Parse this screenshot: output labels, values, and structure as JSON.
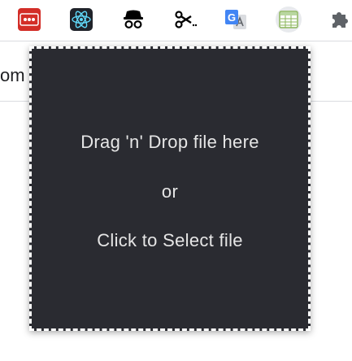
{
  "toolbar": {
    "extensions": [
      {
        "name": "lastpass-icon"
      },
      {
        "name": "react-devtools-icon"
      },
      {
        "name": "incognito-icon"
      },
      {
        "name": "scissors-icon"
      },
      {
        "name": "google-translate-icon"
      },
      {
        "name": "table-capture-icon"
      },
      {
        "name": "puzzle-icon"
      }
    ]
  },
  "background": {
    "partial_text": "om"
  },
  "dropzone": {
    "line1": "Drag 'n' Drop file here",
    "line2": "or",
    "line3": "Click to Select file"
  },
  "colors": {
    "dropzone_bg": "#2a2b31",
    "dropzone_text": "#e6e6e6",
    "lastpass_red": "#d32d27",
    "react_blue": "#61dafb",
    "translate_blue": "#4285f4"
  }
}
